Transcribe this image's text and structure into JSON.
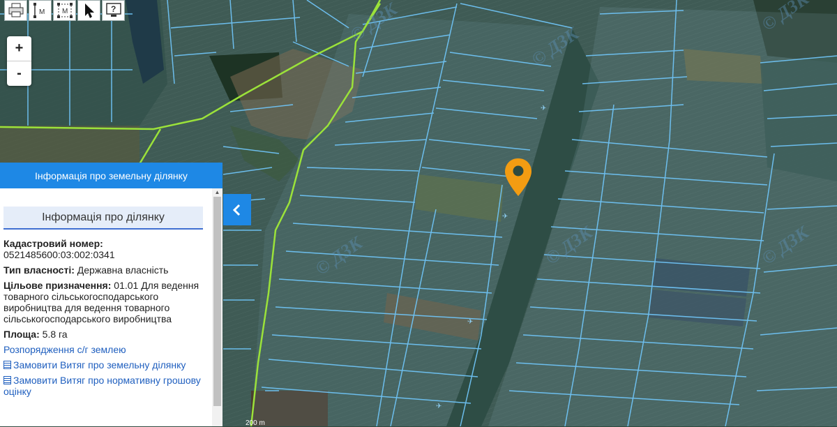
{
  "toolbar": {
    "print_icon": "printer-icon",
    "measure_line_icon": "measure-line-icon",
    "measure_area_icon": "measure-area-icon",
    "pointer_icon": "pointer-icon",
    "help_icon": "help-icon",
    "measure_line_letter": "M",
    "measure_area_letter": "M",
    "help_letter": "?"
  },
  "zoom": {
    "in_label": "+",
    "out_label": "-"
  },
  "panel": {
    "header": "Інформація про земельну ділянку",
    "section_title": "Інформація про ділянку",
    "cadastral_label": "Кадастровий номер:",
    "cadastral_value": "0521485600:03:002:0341",
    "ownership_label": "Тип власності:",
    "ownership_value": "Державна власність",
    "purpose_label": "Цільове призначення:",
    "purpose_value": "01.01 Для ведення товарного сільськогосподарського виробництва для ведення товарного сільськогосподарського виробництва",
    "area_label": "Площа:",
    "area_value": "5.8 га",
    "link_disposal": "Розпорядження с/г землею",
    "link_extract": "Замовити Витяг про земельну ділянку",
    "link_normative": "Замовити Витяг про нормативну грошову оцінку"
  },
  "collapse_icon": "chevron-left-icon",
  "marker_icon": "map-pin-icon",
  "watermark": "© ДЗК",
  "scale_label": "200 m",
  "colors": {
    "accent": "#1e88e5",
    "marker": "#f39c12",
    "parcel_border": "#6fc3f5",
    "boundary": "#9be23a"
  }
}
